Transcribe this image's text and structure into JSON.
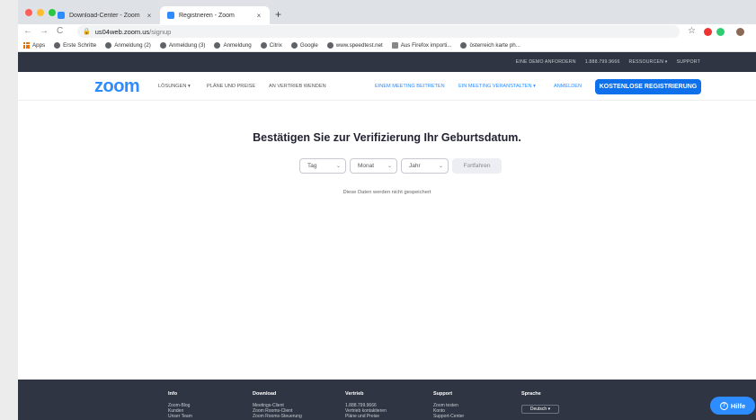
{
  "browser": {
    "tabs": [
      {
        "label": "Download-Center - Zoom",
        "close": "×"
      },
      {
        "label": "Registrieren - Zoom",
        "close": "×"
      }
    ],
    "new_tab": "+",
    "url_host": "us04web.zoom.us",
    "url_path": "/signup",
    "nav": {
      "back": "←",
      "forward": "→",
      "reload": "C"
    },
    "star": "☆",
    "bookmarks": [
      "Apps",
      "Erste Schritte",
      "Anmeldung (2)",
      "Anmeldung (3)",
      "Anmeldung",
      "Citrix",
      "Google",
      "www.speedtest.net",
      "Aus Firefox importi...",
      "österreich karte ph..."
    ]
  },
  "zoom": {
    "topbar": [
      "EINE DEMO ANFORDERN",
      "1.888.799.9666",
      "RESSOURCEN ▾",
      "SUPPORT"
    ],
    "logo": "zoom",
    "nav_left": [
      "LÖSUNGEN ▾",
      "PLÄNE UND PREISE",
      "AN VERTRIEB WENDEN"
    ],
    "nav_right": [
      "EINEM MEETING BEITRETEN",
      "EIN MEETING VERANSTALTEN ▾",
      "ANMELDEN"
    ],
    "signup": "KOSTENLOSE REGISTRIERUNG"
  },
  "content": {
    "heading": "Bestätigen Sie zur Verifizierung Ihr Geburtsdatum.",
    "selects": [
      "Tag",
      "Monat",
      "Jahr"
    ],
    "chevron": "⌄",
    "continue": "Fortfahren",
    "note": "Diese Daten werden nicht gespeichert"
  },
  "footer": {
    "columns": [
      {
        "title": "Info",
        "items": [
          "Zoom-Blog",
          "Kunden",
          "Unser Team"
        ]
      },
      {
        "title": "Download",
        "items": [
          "Meetings-Client",
          "Zoom Rooms-Client",
          "Zoom Rooms-Steuerung"
        ]
      },
      {
        "title": "Vertrieb",
        "items": [
          "1.888.799.9666",
          "Vertrieb kontaktieren",
          "Pläne und Preise"
        ]
      },
      {
        "title": "Support",
        "items": [
          "Zoom testen",
          "Konto",
          "Support-Center"
        ]
      },
      {
        "title": "Sprache",
        "items": []
      }
    ],
    "language": "Deutsch ▾"
  },
  "help": {
    "icon": "?",
    "label": "Hilfe"
  },
  "colors": {
    "brand": "#2d8cff",
    "button": "#0e71eb",
    "dark": "#2f3542"
  }
}
